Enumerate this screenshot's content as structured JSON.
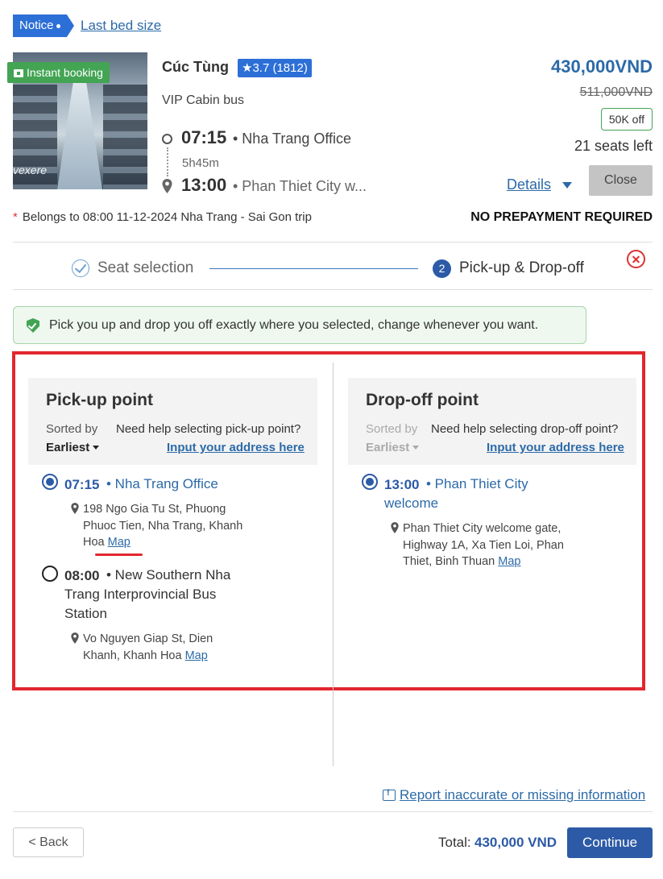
{
  "header": {
    "notice_label": "Notice",
    "last_bed_link": "Last bed size"
  },
  "trip": {
    "instant_booking": "Instant booking",
    "image_brand": "vexere",
    "operator": "Cúc Tùng",
    "rating": "3.7 (1812)",
    "bus_type": "VIP Cabin bus",
    "departure_time": "07:15",
    "departure_place": "• Nha Trang Office",
    "duration": "5h45m",
    "arrival_time": "13:00",
    "arrival_place": "• Phan Thiet City w...",
    "price": "430,000VND",
    "original_price": "511,000VND",
    "discount": "50K off",
    "seats_left": "21 seats left",
    "details_link": "Details",
    "close_button": "Close",
    "belongs_note": "Belongs to 08:00 11-12-2024 Nha Trang - Sai Gon trip",
    "prepayment": "NO PREPAYMENT REQUIRED"
  },
  "steps": [
    {
      "number": "",
      "label": "Seat selection"
    },
    {
      "number": "2",
      "label": "Pick-up & Drop-off"
    }
  ],
  "banner": {
    "text": "Pick you up and drop you off exactly where you selected, change whenever you want."
  },
  "pickup": {
    "title": "Pick-up point",
    "sorted_by": "Sorted by",
    "sort_value": "Earliest",
    "help_text": "Need help selecting pick-up point?",
    "input_link": "Input your address here",
    "points": [
      {
        "time": "07:15",
        "name": "• Nha Trang Office",
        "address": "198 Ngo Gia Tu St, Phuong Phuoc Tien, Nha Trang, Khanh Hoa",
        "map": "Map",
        "selected": true
      },
      {
        "time": "08:00",
        "name": "• New Southern Nha Trang Interprovincial Bus Station",
        "address": "Vo Nguyen Giap St, Dien Khanh, Khanh Hoa",
        "map": "Map",
        "selected": false
      }
    ]
  },
  "dropoff": {
    "title": "Drop-off point",
    "sorted_by": "Sorted by",
    "sort_value": "Earliest",
    "help_text": "Need help selecting drop-off point?",
    "input_link": "Input your address here",
    "points": [
      {
        "time": "13:00",
        "name": "• Phan Thiet City welcome",
        "address": "Phan Thiet City welcome gate, Highway 1A, Xa Tien Loi, Phan Thiet, Binh Thuan",
        "map": "Map",
        "selected": true
      }
    ]
  },
  "footer": {
    "report_link": "Report inaccurate or missing information",
    "back_button": "< Back",
    "total_label": "Total:",
    "total_value": "430,000 VND",
    "continue_button": "Continue"
  },
  "colors": {
    "primary": "#2c5aa6",
    "link": "#2c6aa8",
    "success": "#43a454",
    "highlight_border": "#e3262f"
  }
}
